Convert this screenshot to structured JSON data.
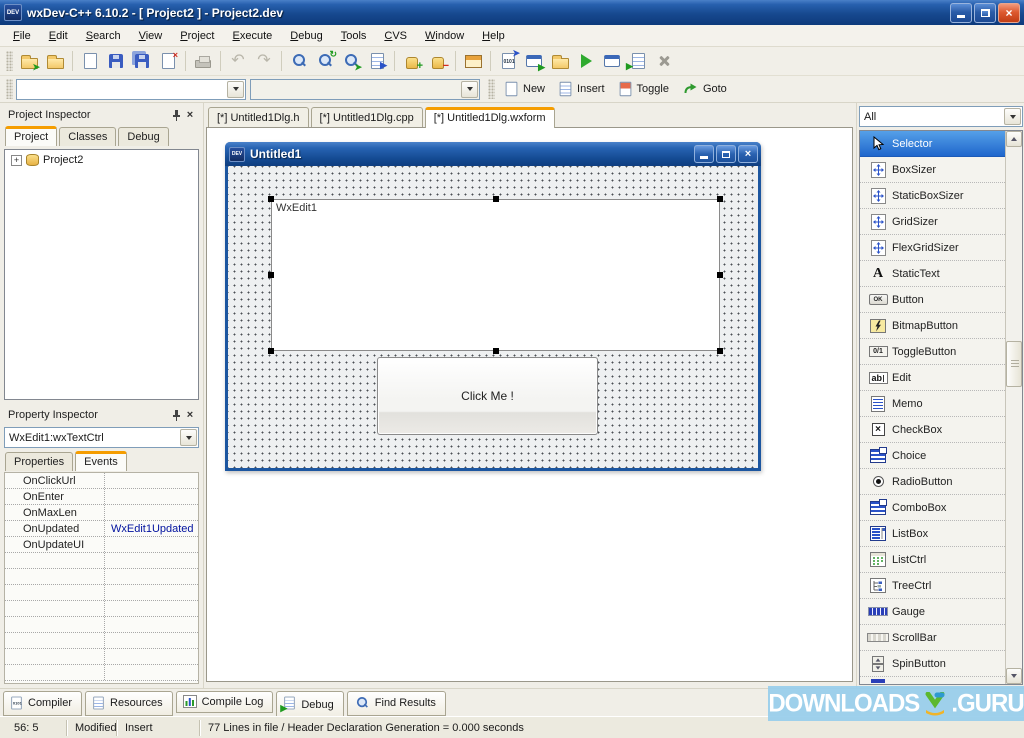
{
  "window": {
    "title": "wxDev-C++ 6.10.2 - [ Project2 ] - Project2.dev"
  },
  "icon_text": {
    "dev": "DEV",
    "ok": "OK",
    "toggle": "0/1",
    "edit": "ab",
    "static": "A",
    "code": "0101"
  },
  "menu": {
    "items": [
      "File",
      "Edit",
      "Search",
      "View",
      "Project",
      "Execute",
      "Debug",
      "Tools",
      "CVS",
      "Window",
      "Help"
    ]
  },
  "toolbar": {
    "combo1": "",
    "combo2": "",
    "buttons": {
      "new": "New",
      "insert": "Insert",
      "toggle": "Toggle",
      "goto": "Goto"
    }
  },
  "project_inspector": {
    "title": "Project Inspector",
    "tabs": [
      "Project",
      "Classes",
      "Debug"
    ],
    "expand_glyph": "+",
    "tree_root": "Project2"
  },
  "property_inspector": {
    "title": "Property Inspector",
    "object_selector": "WxEdit1:wxTextCtrl",
    "tabs": [
      "Properties",
      "Events"
    ],
    "events": [
      {
        "name": "OnClickUrl",
        "value": ""
      },
      {
        "name": "OnEnter",
        "value": ""
      },
      {
        "name": "OnMaxLen",
        "value": ""
      },
      {
        "name": "OnUpdated",
        "value": "WxEdit1Updated"
      },
      {
        "name": "OnUpdateUI",
        "value": ""
      }
    ]
  },
  "editor": {
    "tabs": [
      "[*] Untitled1Dlg.h",
      "[*] Untitled1Dlg.cpp",
      "[*] Untitled1Dlg.wxform"
    ]
  },
  "designer": {
    "title": "Untitled1",
    "edit_text": "WxEdit1",
    "button_label": "Click Me !"
  },
  "palette": {
    "filter": "All",
    "items": [
      "Selector",
      "BoxSizer",
      "StaticBoxSizer",
      "GridSizer",
      "FlexGridSizer",
      "StaticText",
      "Button",
      "BitmapButton",
      "ToggleButton",
      "Edit",
      "Memo",
      "CheckBox",
      "Choice",
      "RadioButton",
      "ComboBox",
      "ListBox",
      "ListCtrl",
      "TreeCtrl",
      "Gauge",
      "ScrollBar",
      "SpinButton"
    ]
  },
  "bottom_tabs": [
    "Compiler",
    "Resources",
    "Compile Log",
    "Debug",
    "Find Results"
  ],
  "status": {
    "cursor": "56: 5",
    "modified": "Modified",
    "mode": "Insert",
    "message": "77 Lines in file / Header Declaration Generation = 0.000 seconds"
  },
  "watermark": {
    "left": "DOWNLOADS",
    "right": ".GURU"
  }
}
